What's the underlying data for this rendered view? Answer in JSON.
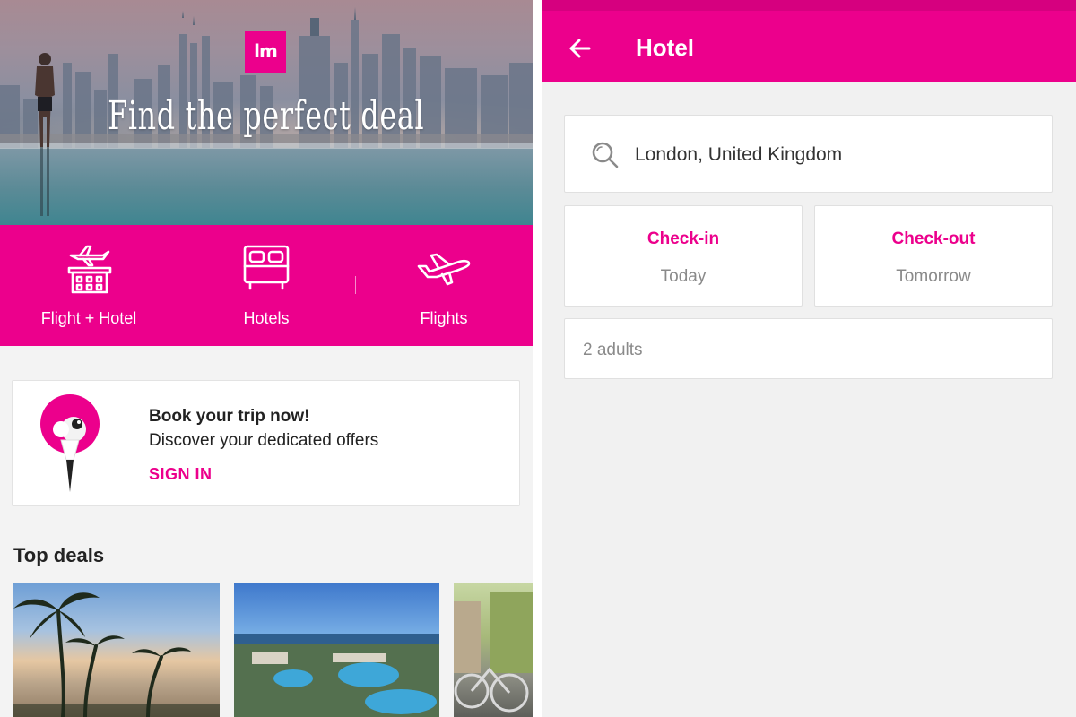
{
  "colors": {
    "brand_pink": "#ec008c",
    "text_dark": "#222222",
    "text_muted": "#8a8a8a",
    "background": "#f3f3f3"
  },
  "left_screen": {
    "hero": {
      "logo_text": "lm",
      "tagline": "Find the perfect deal"
    },
    "categories": [
      {
        "label": "Flight + Hotel",
        "icon": "flight-hotel-icon"
      },
      {
        "label": "Hotels",
        "icon": "bed-icon"
      },
      {
        "label": "Flights",
        "icon": "airplane-icon"
      }
    ],
    "signin_card": {
      "title": "Book your trip now!",
      "subtitle": "Discover your dedicated offers",
      "link_label": "SIGN IN",
      "mascot_icon": "flamingo-mascot-icon"
    },
    "top_deals": {
      "title": "Top deals",
      "cards": [
        {
          "image": "palm-beach-photo"
        },
        {
          "image": "resort-pool-photo"
        },
        {
          "image": "city-bicycles-photo"
        }
      ]
    }
  },
  "right_screen": {
    "appbar": {
      "back_icon": "arrow-left-icon",
      "title": "Hotel"
    },
    "search": {
      "icon": "search-icon",
      "value": "London, United Kingdom"
    },
    "check_in": {
      "label": "Check-in",
      "value": "Today"
    },
    "check_out": {
      "label": "Check-out",
      "value": "Tomorrow"
    },
    "guests": {
      "value": "2 adults"
    }
  }
}
